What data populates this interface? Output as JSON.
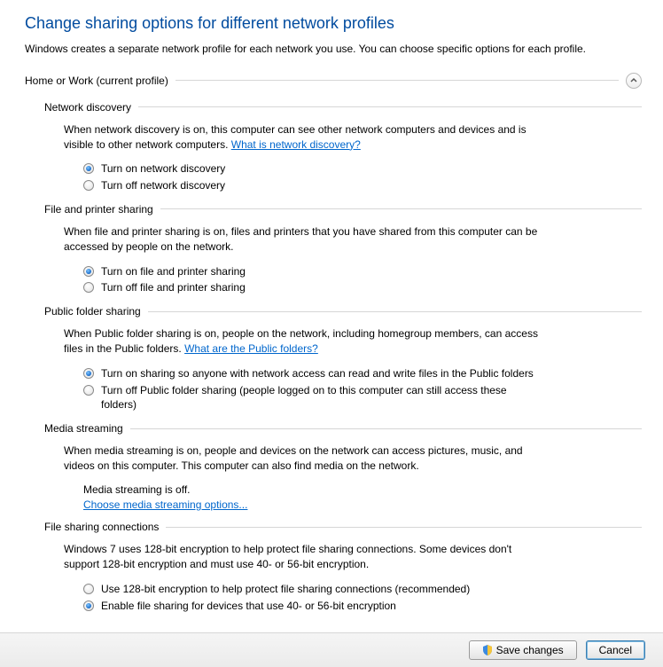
{
  "page": {
    "title": "Change sharing options for different network profiles",
    "desc": "Windows creates a separate network profile for each network you use. You can choose specific options for each profile."
  },
  "profile": {
    "name": "Home or Work (current profile)"
  },
  "discovery": {
    "title": "Network discovery",
    "desc": "When network discovery is on, this computer can see other network computers and devices and is visible to other network computers. ",
    "link": "What is network discovery?",
    "on": "Turn on network discovery",
    "off": "Turn off network discovery"
  },
  "filePrinter": {
    "title": "File and printer sharing",
    "desc": "When file and printer sharing is on, files and printers that you have shared from this computer can be accessed by people on the network.",
    "on": "Turn on file and printer sharing",
    "off": "Turn off file and printer sharing"
  },
  "publicFolder": {
    "title": "Public folder sharing",
    "desc": "When Public folder sharing is on, people on the network, including homegroup members, can access files in the Public folders. ",
    "link": "What are the Public folders?",
    "on": "Turn on sharing so anyone with network access can read and write files in the Public folders",
    "off": "Turn off Public folder sharing (people logged on to this computer can still access these folders)"
  },
  "media": {
    "title": "Media streaming",
    "desc": "When media streaming is on, people and devices on the network can access pictures, music, and videos on this computer. This computer can also find media on the network.",
    "status": "Media streaming is off.",
    "link": "Choose media streaming options..."
  },
  "fileSharing": {
    "title": "File sharing connections",
    "desc": "Windows 7 uses 128-bit encryption to help protect file sharing connections. Some devices don't support 128-bit encryption and must use 40- or 56-bit encryption.",
    "on": "Use 128-bit encryption to help protect file sharing connections (recommended)",
    "off": "Enable file sharing for devices that use 40- or 56-bit encryption"
  },
  "footer": {
    "save": "Save changes",
    "cancel": "Cancel"
  }
}
